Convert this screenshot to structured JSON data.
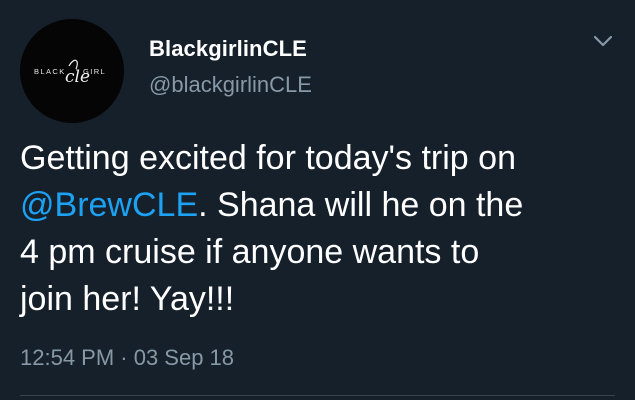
{
  "user": {
    "display_name": "BlackgirlinCLE",
    "handle": "@blackgirlinCLE",
    "avatar_text_left": "BLACK",
    "avatar_text_right": "GIRL",
    "avatar_script": "cle",
    "avatar_bg": "#050505"
  },
  "tweet": {
    "line1": "Getting excited for today's trip on",
    "mention": "@BrewCLE",
    "line2_rest": ". Shana will he on the",
    "line3": "4 pm cruise if anyone wants to",
    "line4": "join her! Yay!!!",
    "timestamp": "12:54 PM · 03 Sep 18"
  },
  "menu": {
    "icon": "chevron-down-icon"
  },
  "colors": {
    "background": "#15202b",
    "text": "#ffffff",
    "secondary": "#8899a6",
    "link": "#1da1f2"
  }
}
